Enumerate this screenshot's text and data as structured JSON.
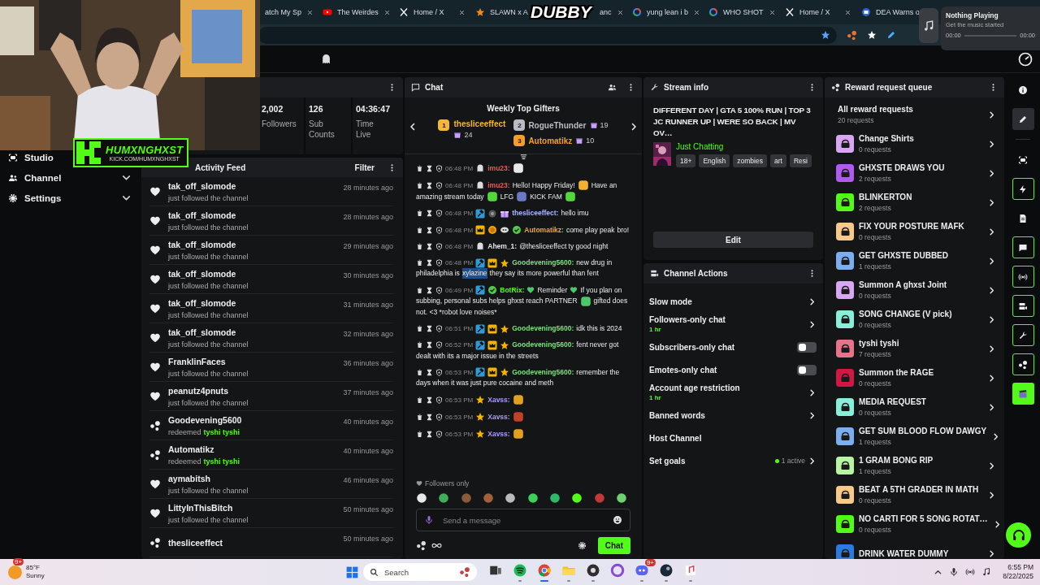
{
  "browser": {
    "tabs": [
      {
        "kind": "none",
        "title": "atch My Sp"
      },
      {
        "kind": "video",
        "title": "The Weirdes"
      },
      {
        "kind": "cross",
        "title": "Home / X"
      },
      {
        "kind": "star",
        "title": "SLAWN x A"
      },
      {
        "kind": "none",
        "title": "anc"
      },
      {
        "kind": "globe",
        "title": "yung lean i b"
      },
      {
        "kind": "globe",
        "title": "WHO SHOT"
      },
      {
        "kind": "cross",
        "title": "Home / X"
      },
      {
        "kind": "news",
        "title": "DEA Warns o"
      }
    ]
  },
  "media_popup": {
    "title": "Nothing Playing",
    "subtitle": "Get the music started",
    "elapsed": "00:00",
    "duration": "00:00"
  },
  "overlays": {
    "stream_logo": "DUBBY",
    "channel_name": "HUMXNGHXST",
    "channel_url": "KICK.COM/HUMXNGHXST"
  },
  "sidebar": {
    "items": [
      {
        "kind": "link",
        "label": "Studio"
      },
      {
        "kind": "group",
        "label": "Channel",
        "expanded": false
      },
      {
        "kind": "group",
        "label": "Settings",
        "expanded": false
      }
    ]
  },
  "stats": [
    {
      "value": "2,002",
      "label": "Followers"
    },
    {
      "value": "126",
      "label": "Sub Counts"
    },
    {
      "value": "04:36:47",
      "label": "Time Live"
    }
  ],
  "activity_feed": {
    "title": "Activity Feed",
    "filter": "Filter",
    "events": [
      {
        "kind": "follow",
        "user": "tak_off_slomode",
        "action": "just followed the channel",
        "time": "28 minutes ago"
      },
      {
        "kind": "follow",
        "user": "tak_off_slomode",
        "action": "just followed the channel",
        "time": "28 minutes ago"
      },
      {
        "kind": "follow",
        "user": "tak_off_slomode",
        "action": "just followed the channel",
        "time": "29 minutes ago"
      },
      {
        "kind": "follow",
        "user": "tak_off_slomode",
        "action": "just followed the channel",
        "time": "30 minutes ago"
      },
      {
        "kind": "follow",
        "user": "tak_off_slomode",
        "action": "just followed the channel",
        "time": "31 minutes ago"
      },
      {
        "kind": "follow",
        "user": "tak_off_slomode",
        "action": "just followed the channel",
        "time": "32 minutes ago"
      },
      {
        "kind": "follow",
        "user": "FranklinFaces",
        "action": "just followed the channel",
        "time": "36 minutes ago"
      },
      {
        "kind": "follow",
        "user": "peanutz4pnuts",
        "action": "just followed the channel",
        "time": "37 minutes ago"
      },
      {
        "kind": "redeem",
        "user": "Goodevening5600",
        "action": "redeemed",
        "reward": "tyshi tyshi",
        "time": "40 minutes ago"
      },
      {
        "kind": "redeem",
        "user": "Automatikz",
        "action": "redeemed",
        "reward": "tyshi tyshi",
        "time": "40 minutes ago"
      },
      {
        "kind": "follow",
        "user": "aymabitsh",
        "action": "just followed the channel",
        "time": "46 minutes ago"
      },
      {
        "kind": "follow",
        "user": "LittyInThisBitch",
        "action": "just followed the channel",
        "time": "50 minutes ago"
      },
      {
        "kind": "redeem",
        "user": "thesliceeffect",
        "time": "50 minutes ago"
      }
    ]
  },
  "chat": {
    "title": "Chat",
    "top_gifters": {
      "title": "Weekly Top Gifters",
      "gifters": [
        {
          "rank": "1",
          "name": "thesliceeffect",
          "count": "24",
          "color": "#f5b82e"
        },
        {
          "rank": "2",
          "name": "RogueThunder",
          "count": "19",
          "color": "#b9bcc2"
        },
        {
          "rank": "3",
          "name": "Automatikz",
          "count": "10",
          "color": "#f59e2e"
        }
      ]
    },
    "messages": [
      {
        "time": "06:48 PM",
        "badges": [
          {
            "kind": "ghost"
          }
        ],
        "user": "imu23:",
        "color": "#e0605a",
        "parts": [
          {
            "kind": "emote",
            "color": "#e8e8e8"
          }
        ]
      },
      {
        "time": "06:48 PM",
        "badges": [
          {
            "kind": "ghost"
          }
        ],
        "user": "imu23:",
        "color": "#e0605a",
        "parts": [
          {
            "kind": "text",
            "text": "Hello! Happy Friday!"
          },
          {
            "kind": "emote",
            "color": "#f0b030"
          },
          {
            "kind": "text",
            "text": "Have an"
          },
          {
            "kind": "text",
            "text": "amazing stream today"
          },
          {
            "kind": "emote",
            "color": "#53d83a"
          },
          {
            "kind": "text",
            "text": "LFG"
          },
          {
            "kind": "emote",
            "color": "#6a78c8"
          },
          {
            "kind": "text",
            "text": "KICK FAM"
          },
          {
            "kind": "emote",
            "color": "#53d83a"
          }
        ]
      },
      {
        "time": "06:48 PM",
        "badges": [
          {
            "kind": "mod"
          },
          {
            "kind": "spin"
          },
          {
            "kind": "gift"
          }
        ],
        "user": "thesliceeffect:",
        "color": "#a9b8ff",
        "parts": [
          {
            "kind": "text",
            "text": "hello imu"
          }
        ]
      },
      {
        "time": "06:48 PM",
        "badges": [
          {
            "kind": "vip"
          },
          {
            "kind": "coin"
          },
          {
            "kind": "eyes"
          },
          {
            "kind": "verified"
          }
        ],
        "user": "Automatikz:",
        "color": "#f5a623",
        "parts": [
          {
            "kind": "text",
            "text": "come play peak"
          },
          {
            "kind": "text",
            "text": "bro!"
          }
        ]
      },
      {
        "time": "06:48 PM",
        "badges": [
          {
            "kind": "ghost"
          }
        ],
        "user": "Ahem_1:",
        "color": "#e6e6e6",
        "parts": [
          {
            "kind": "text",
            "text": "@thesliceeffect ty good night"
          }
        ]
      },
      {
        "time": "06:48 PM",
        "badges": [
          {
            "kind": "mod"
          },
          {
            "kind": "vip"
          },
          {
            "kind": "star"
          }
        ],
        "user": "Goodevening5600:",
        "color": "#7ee07e",
        "parts": [
          {
            "kind": "text",
            "text": "new drug in"
          },
          {
            "kind": "text",
            "text": "philadelphia is"
          },
          {
            "kind": "highlight",
            "text": "xylazine"
          },
          {
            "kind": "text",
            "text": "they say its more powerful than fent"
          }
        ]
      },
      {
        "time": "06:49 PM",
        "badges": [
          {
            "kind": "mod"
          },
          {
            "kind": "verified"
          }
        ],
        "user": "BotRix:",
        "color": "#53fc18",
        "parts": [
          {
            "kind": "heart",
            "color": "#4cc86a"
          },
          {
            "kind": "text",
            "text": "Reminder"
          },
          {
            "kind": "heart",
            "color": "#4cc86a"
          },
          {
            "kind": "text",
            "text": "If you plan on"
          },
          {
            "kind": "text",
            "text": "subbing, personal subs helps ghxst reach PARTNER"
          },
          {
            "kind": "emote",
            "color": "#4cc86a"
          },
          {
            "kind": "text",
            "text": "gifted does"
          },
          {
            "kind": "text",
            "text": "not. <3 *robot love noises*"
          }
        ]
      },
      {
        "time": "06:51 PM",
        "badges": [
          {
            "kind": "mod"
          },
          {
            "kind": "vip"
          },
          {
            "kind": "star"
          }
        ],
        "user": "Goodevening5600:",
        "color": "#7ee07e",
        "parts": [
          {
            "kind": "text",
            "text": "idk this is 2024"
          }
        ]
      },
      {
        "time": "06:52 PM",
        "badges": [
          {
            "kind": "mod"
          },
          {
            "kind": "vip"
          },
          {
            "kind": "star"
          }
        ],
        "user": "Goodevening5600:",
        "color": "#7ee07e",
        "parts": [
          {
            "kind": "text",
            "text": "fent never got"
          },
          {
            "kind": "text",
            "text": "dealt with its a major issue in the streets"
          }
        ]
      },
      {
        "time": "06:53 PM",
        "badges": [
          {
            "kind": "mod"
          },
          {
            "kind": "vip"
          },
          {
            "kind": "star"
          }
        ],
        "user": "Goodevening5600:",
        "color": "#7ee07e",
        "parts": [
          {
            "kind": "text",
            "text": "remember the"
          },
          {
            "kind": "text",
            "text": "days when it was just pure cocaine and meth"
          }
        ]
      },
      {
        "time": "06:53 PM",
        "badges": [
          {
            "kind": "star"
          }
        ],
        "user": "Xavss:",
        "color": "#a99cff",
        "parts": [
          {
            "kind": "emote",
            "color": "#e0a020"
          }
        ]
      },
      {
        "time": "06:53 PM",
        "badges": [
          {
            "kind": "star"
          }
        ],
        "user": "Xavss:",
        "color": "#a99cff",
        "parts": [
          {
            "kind": "emote",
            "color": "#c0402a"
          }
        ]
      },
      {
        "time": "06:53 PM",
        "badges": [
          {
            "kind": "star"
          }
        ],
        "user": "Xavss:",
        "color": "#a99cff",
        "parts": [
          {
            "kind": "emote",
            "color": "#e0a020"
          }
        ]
      }
    ],
    "mode": "Followers only",
    "emotes": [
      {
        "color": "#e8e8e8"
      },
      {
        "color": "#3fae5a"
      },
      {
        "color": "#8a5a3a"
      },
      {
        "color": "#a0603a"
      },
      {
        "color": "#bbbbbb"
      },
      {
        "color": "#3fcf5a"
      },
      {
        "color": "#2fb86a"
      },
      {
        "color": "#53fc18"
      },
      {
        "color": "#c0383a"
      },
      {
        "color": "#6fd06f"
      }
    ],
    "input": {
      "placeholder": "Send a message"
    },
    "send": "Chat"
  },
  "stream_info": {
    "title": "Stream info",
    "stream_title": "DIFFERENT DAY | GTA 5 100% RUN | TOP 3 JC RUNNER UP | WERE SO BACK | MV OV…",
    "category": "Just Chatting",
    "tags": [
      "18+",
      "English",
      "zombies",
      "art",
      "Resi"
    ],
    "edit": "Edit"
  },
  "channel_actions": {
    "title": "Channel Actions",
    "items": [
      {
        "kind": "link",
        "label": "Slow mode"
      },
      {
        "kind": "link",
        "label": "Followers-only chat",
        "value": "1 hr"
      },
      {
        "kind": "toggle",
        "label": "Subscribers-only chat",
        "on": false
      },
      {
        "kind": "toggle",
        "label": "Emotes-only chat",
        "on": false
      },
      {
        "kind": "link",
        "label": "Account age restriction",
        "value": "1 hr"
      },
      {
        "kind": "link",
        "label": "Banned words"
      },
      {
        "kind": "plain",
        "label": "Host Channel"
      },
      {
        "kind": "status",
        "label": "Set goals",
        "value": "1 active"
      }
    ]
  },
  "reward_queue": {
    "title": "Reward request queue",
    "all": {
      "label": "All reward requests",
      "count": "20 requests"
    },
    "rewards": [
      {
        "name": "Change Shirts",
        "count": "0 requests",
        "color": "#d9a6f5"
      },
      {
        "name": "GHXSTE DRAWS YOU",
        "count": "2 requests",
        "color": "#b25af0"
      },
      {
        "name": "BLINKERTON",
        "count": "2 requests",
        "color": "#53fc18"
      },
      {
        "name": "FIX YOUR POSTURE MAFK",
        "count": "0 requests",
        "color": "#f9c98a"
      },
      {
        "name": "GET GHXSTE DUBBED",
        "count": "1 requests",
        "color": "#7aaef0"
      },
      {
        "name": "Summon A ghxst Joint",
        "count": "0 requests",
        "color": "#d9a6f5"
      },
      {
        "name": "SONG CHANGE (V pick)",
        "count": "0 requests",
        "color": "#88f0d8"
      },
      {
        "name": "tyshi tyshi",
        "count": "7 requests",
        "color": "#e8728a"
      },
      {
        "name": "Summon the RAGE",
        "count": "0 requests",
        "color": "#d01842"
      },
      {
        "name": "MEDIA REQUEST",
        "count": "0 requests",
        "color": "#88f0d8"
      },
      {
        "name": "GET SUM BLOOD FLOW DAWGY",
        "count": "1 requests",
        "color": "#7aaef0"
      },
      {
        "name": "1 GRAM BONG RIP",
        "count": "1 requests",
        "color": "#b8f5a0"
      },
      {
        "name": "BEAT A 5TH GRADER IN MATH",
        "count": "0 requests",
        "color": "#f9c98a"
      },
      {
        "name": "NO CARTI FOR 5 SONG ROTAT…",
        "count": "0 requests",
        "color": "#53fc18"
      },
      {
        "name": "DRINK WATER DUMMY",
        "color": "#2a7be0"
      }
    ]
  },
  "rail": [
    {
      "kind": "info",
      "selected": false,
      "pinned": false
    },
    {
      "kind": "pencil",
      "selected": true,
      "pinned": false
    },
    {
      "kind": "camera",
      "selected": false,
      "pinned": false
    },
    {
      "kind": "bolt",
      "selected": false,
      "pinned": true
    },
    {
      "kind": "document",
      "selected": false,
      "pinned": false
    },
    {
      "kind": "chat",
      "selected": false,
      "pinned": true
    },
    {
      "kind": "broadcast",
      "selected": false,
      "pinned": true
    },
    {
      "kind": "video",
      "selected": false,
      "pinned": true
    },
    {
      "kind": "wrench",
      "selected": false,
      "pinned": true
    },
    {
      "kind": "dots",
      "selected": false,
      "pinned": true
    },
    {
      "kind": "clapper",
      "selected": false,
      "pinned": false
    }
  ],
  "taskbar": {
    "weather": {
      "badge": "9+",
      "temp": "85°F",
      "condition": "Sunny"
    },
    "search": {
      "placeholder": "Search"
    },
    "apps": [
      {
        "kind": "taskview",
        "running": false,
        "selected": false
      },
      {
        "kind": "spotify",
        "running": true,
        "selected": false
      },
      {
        "kind": "chrome",
        "running": true,
        "selected": true
      },
      {
        "kind": "folder",
        "running": true,
        "selected": false
      },
      {
        "kind": "obs",
        "running": true,
        "selected": false
      },
      {
        "kind": "ring",
        "running": false,
        "selected": false
      },
      {
        "kind": "discord",
        "running": true,
        "selected": false,
        "badge": "9+"
      },
      {
        "kind": "steam",
        "running": true,
        "selected": false
      },
      {
        "kind": "music",
        "running": true,
        "selected": false
      }
    ],
    "time": "6:55 PM",
    "date": "8/22/2025"
  }
}
